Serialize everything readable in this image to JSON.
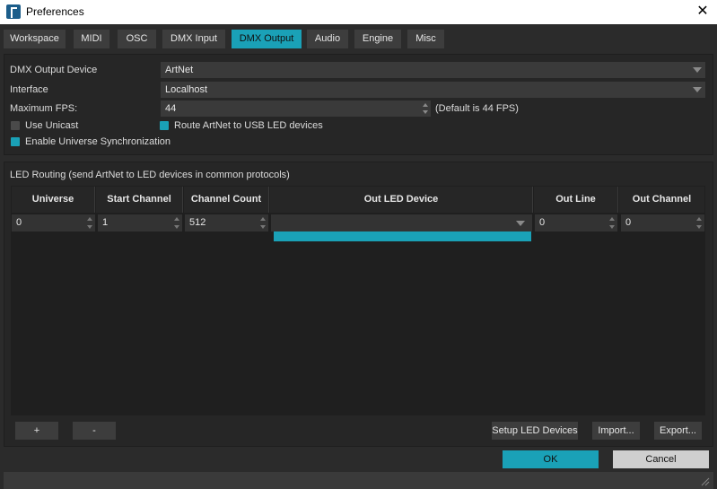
{
  "window": {
    "title": "Preferences"
  },
  "tabs": [
    {
      "label": "Workspace",
      "active": false
    },
    {
      "label": "MIDI",
      "active": false
    },
    {
      "label": "OSC",
      "active": false
    },
    {
      "label": "DMX Input",
      "active": false
    },
    {
      "label": "DMX Output",
      "active": true
    },
    {
      "label": "Audio",
      "active": false
    },
    {
      "label": "Engine",
      "active": false
    },
    {
      "label": "Misc",
      "active": false
    }
  ],
  "dmx_output": {
    "device_label": "DMX Output Device",
    "device_value": "ArtNet",
    "interface_label": "Interface",
    "interface_value": "Localhost",
    "fps_label": "Maximum FPS:",
    "fps_value": "44",
    "fps_note": "(Default is 44 FPS)",
    "use_unicast_label": "Use Unicast",
    "use_unicast_checked": false,
    "route_artnet_label": "Route ArtNet to USB LED devices",
    "route_artnet_checked": true,
    "enable_sync_label": "Enable Universe Synchronization",
    "enable_sync_checked": true
  },
  "led_routing": {
    "title": "LED Routing (send ArtNet to LED devices in common protocols)",
    "columns": [
      "Universe",
      "Start Channel",
      "Channel Count",
      "Out LED Device",
      "Out Line",
      "Out Channel"
    ],
    "rows": [
      {
        "universe": "0",
        "start_channel": "1",
        "channel_count": "512",
        "out_led_device": "",
        "out_line": "0",
        "out_channel": "0"
      }
    ],
    "add_label": "+",
    "remove_label": "-",
    "setup_label": "Setup LED Devices",
    "import_label": "Import...",
    "export_label": "Export..."
  },
  "footer": {
    "ok_label": "OK",
    "cancel_label": "Cancel"
  },
  "colors": {
    "accent": "#1aa1b7",
    "background": "#2b2b2b",
    "panel": "#262626"
  }
}
